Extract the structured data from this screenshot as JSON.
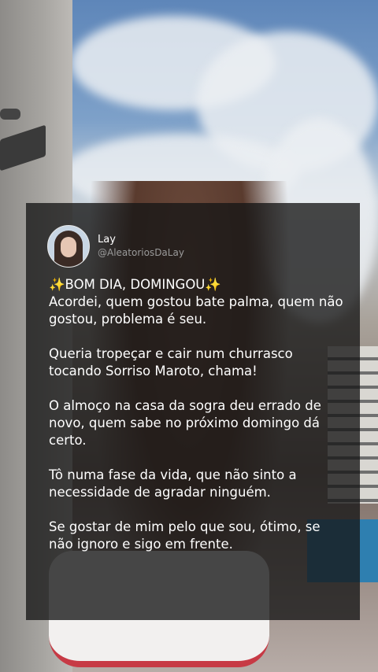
{
  "post": {
    "author_name": "Lay",
    "author_handle": "@AleatoriosDaLay",
    "avatar_icon": "profile-avatar",
    "headline_icon": "sparkles-icon",
    "headline": "BOM DIA, DOMINGOU",
    "lines": [
      "Acordei, quem gostou bate palma, quem não gostou, problema é seu.",
      "Queria tropeçar e cair num churrasco tocando Sorriso Maroto, chama!",
      "O almoço na casa da sogra deu errado de novo, quem sabe no próximo domingo dá certo.",
      "Tô numa fase da vida, que não sinto a necessidade de agradar ninguém.",
      "Se gostar de mim pelo que sou, ótimo, se não ignoro e sigo em frente."
    ]
  },
  "colors": {
    "card_bg": "#161616",
    "sparkle": "#f3c74a",
    "text": "#ffffff",
    "handle": "#9a9a9a"
  }
}
